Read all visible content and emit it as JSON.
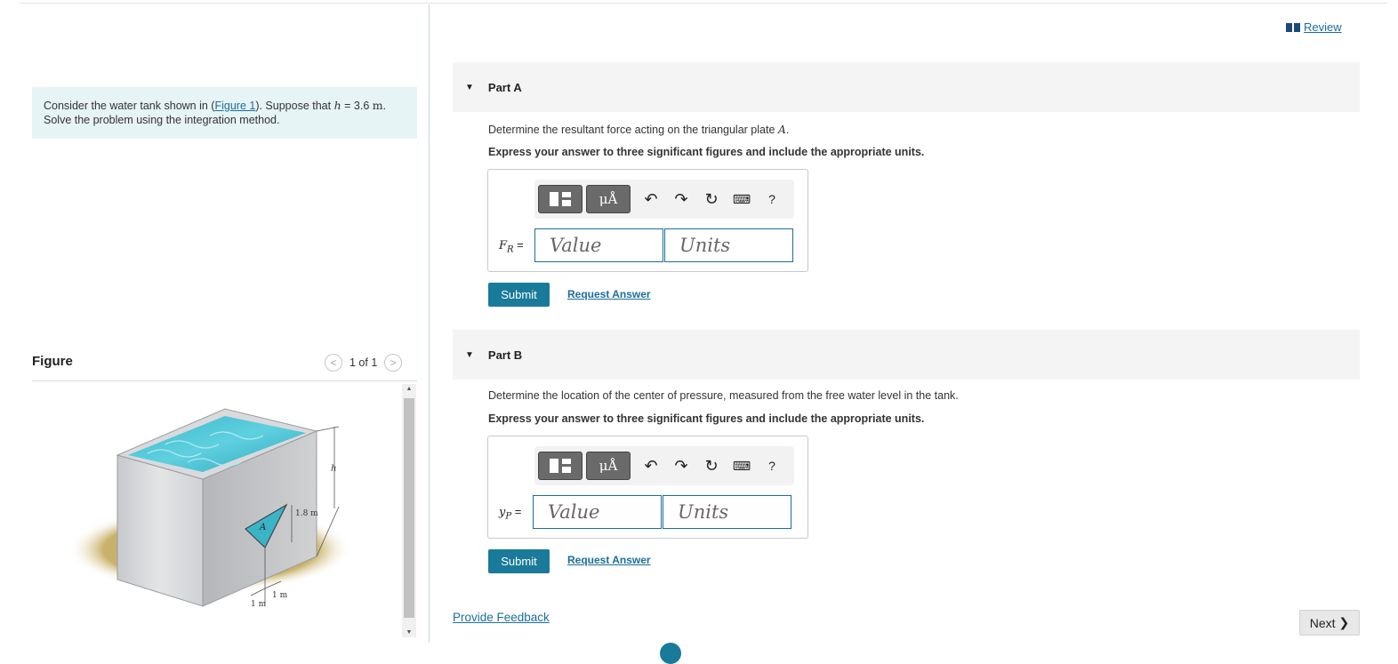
{
  "review": {
    "label": "Review"
  },
  "intro": {
    "before_link": "Consider the water tank shown in (",
    "link": "Figure 1",
    "after_link": "). Suppose that ",
    "var": "h",
    "eq": " = 3.6 ",
    "unit": "m",
    "end": ".",
    "line2": "Solve the problem using the integration method."
  },
  "figure": {
    "title": "Figure",
    "pager": "1 of 1",
    "labels": {
      "h": "h",
      "dim": "1.8 m",
      "plate": "A",
      "w1": "1 m",
      "w2": "1 m"
    }
  },
  "parts": [
    {
      "header": "Part A",
      "question_pre": "Determine the resultant force acting on the triangular plate ",
      "question_var": "A",
      "question_post": ".",
      "instruction": "Express your answer to three significant figures and include the appropriate units.",
      "answer_var": "F",
      "answer_sub": "R",
      "answer_eq": " =",
      "value_placeholder": "Value",
      "units_placeholder": "Units",
      "submit": "Submit",
      "request": "Request Answer"
    },
    {
      "header": "Part B",
      "question_pre": "Determine the location of the center of pressure, measured from the free water level in the tank.",
      "question_var": "",
      "question_post": "",
      "instruction": "Express your answer to three significant figures and include the appropriate units.",
      "answer_var": "y",
      "answer_sub": "P",
      "answer_eq": " =",
      "value_placeholder": "Value",
      "units_placeholder": "Units",
      "submit": "Submit",
      "request": "Request Answer"
    }
  ],
  "toolbar": {
    "mu_label": "μÅ",
    "help": "?"
  },
  "footer": {
    "feedback": "Provide Feedback",
    "next": "Next"
  }
}
